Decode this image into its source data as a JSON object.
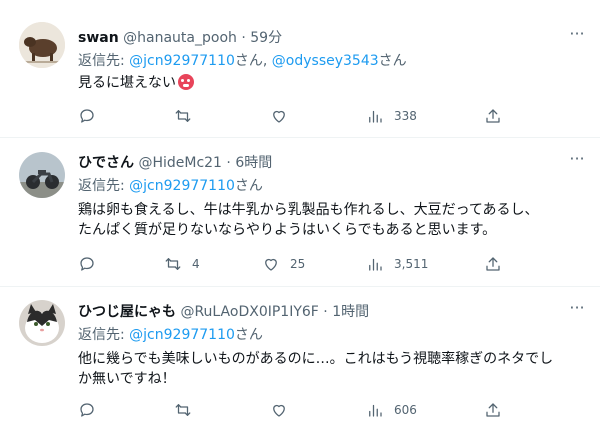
{
  "tweets": [
    {
      "name": "swan",
      "handle": "@hanauta_pooh",
      "dot": "·",
      "time": "59分",
      "reply_prefix": "返信先: ",
      "mentions": [
        "@jcn92977110",
        "@odyssey3543"
      ],
      "san1": "さん, ",
      "san2": "さん",
      "text": "見るに堪えない",
      "emoji": "weary-face-emoji",
      "stats": {
        "reply": "",
        "retweet": "",
        "like": "",
        "views": "338"
      }
    },
    {
      "name": "ひでさん",
      "handle": "@HideMc21",
      "dot": "·",
      "time": "6時間",
      "reply_prefix": "返信先: ",
      "mentions": [
        "@jcn92977110"
      ],
      "san1": "さん",
      "text_line1": "鶏は卵も食えるし、牛は牛乳から乳製品も作れるし、大豆だってあるし、",
      "text_line2": "たんぱく質が足りないならやりようはいくらでもあると思います。",
      "stats": {
        "reply": "",
        "retweet": "4",
        "like": "25",
        "views": "3,511"
      }
    },
    {
      "name": "ひつじ屋にゃも",
      "handle": "@RuLAoDX0IP1IY6F",
      "dot": "·",
      "time": "1時間",
      "reply_prefix": "返信先: ",
      "mentions": [
        "@jcn92977110"
      ],
      "san1": "さん",
      "text_line1": "他に幾らでも美味しいものがあるのに…。これはもう視聴率稼ぎのネタでし",
      "text_line2": "か無いですね！",
      "stats": {
        "reply": "",
        "retweet": "",
        "like": "",
        "views": "606"
      }
    }
  ],
  "more_label": "···",
  "colors": {
    "accent": "#1d9bf0",
    "muted": "#536471",
    "text": "#0f1419"
  }
}
